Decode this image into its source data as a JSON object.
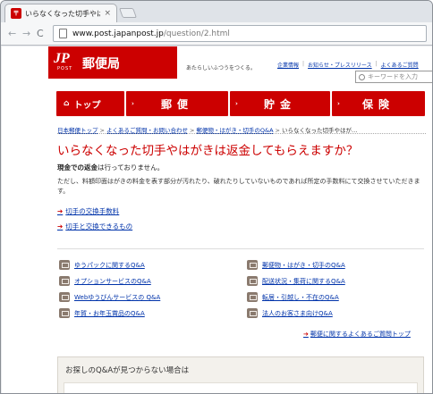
{
  "browser": {
    "tab_title": "いらなくなった切手やはが",
    "tab_close": "×",
    "url_host": "www.post.japanpost.jp",
    "url_path": "/question/2.html",
    "back": "←",
    "forward": "→",
    "reload": "C"
  },
  "header": {
    "logo_mark": "JP",
    "logo_post": "POST",
    "logo_text": "郵便局",
    "tagline": "あたらしいふつうをつくる。",
    "links": [
      "企業情報",
      "お知らせ・プレスリリース",
      "よくあるご質問"
    ],
    "search_placeholder": "キーワードを入力"
  },
  "gnav": {
    "top": "トップ",
    "mail": "郵便",
    "bank": "貯金",
    "insurance": "保険"
  },
  "breadcrumb": [
    "日本郵便トップ",
    "よくあるご質問・お問い合わせ",
    "郵便物・はがき・切手のQ&A",
    "いらなくなった切手やはが…"
  ],
  "breadcrumb_sep": ">",
  "question": {
    "title": "いらなくなった切手やはがきは返金してもらえますか？",
    "lead_bold": "現金での返金",
    "lead_rest": "は行っておりません。",
    "body": "ただし、料額印面はがきの料金を表す部分が汚れたり、破れたりしていないものであれば所定の手数料にて交換させていただきます。"
  },
  "related": [
    {
      "arrow": "➔",
      "label": "切手の交換手数料"
    },
    {
      "arrow": "➔",
      "label": "切手と交換できるもの"
    }
  ],
  "faq_links": {
    "left": [
      "ゆうパックに関するQ&A",
      "オプションサービスのQ&A",
      "Webゆうびんサービスの Q&A",
      "年賀・お年玉賞品のQ&A"
    ],
    "right": [
      "郵便物・はがき・切手のQ&A",
      "配送状況・集荷に関するQ&A",
      "転居・引越し・不在のQ&A",
      "法人のお客さま向けQ&A"
    ]
  },
  "more_link": {
    "arrow": "➔",
    "label": "郵便に関するよくあるご質問トップ"
  },
  "notfound": {
    "title": "お探しのQ&Aが見つからない場合は"
  },
  "colors": {
    "brand": "#cc0000",
    "link": "#0033aa"
  }
}
